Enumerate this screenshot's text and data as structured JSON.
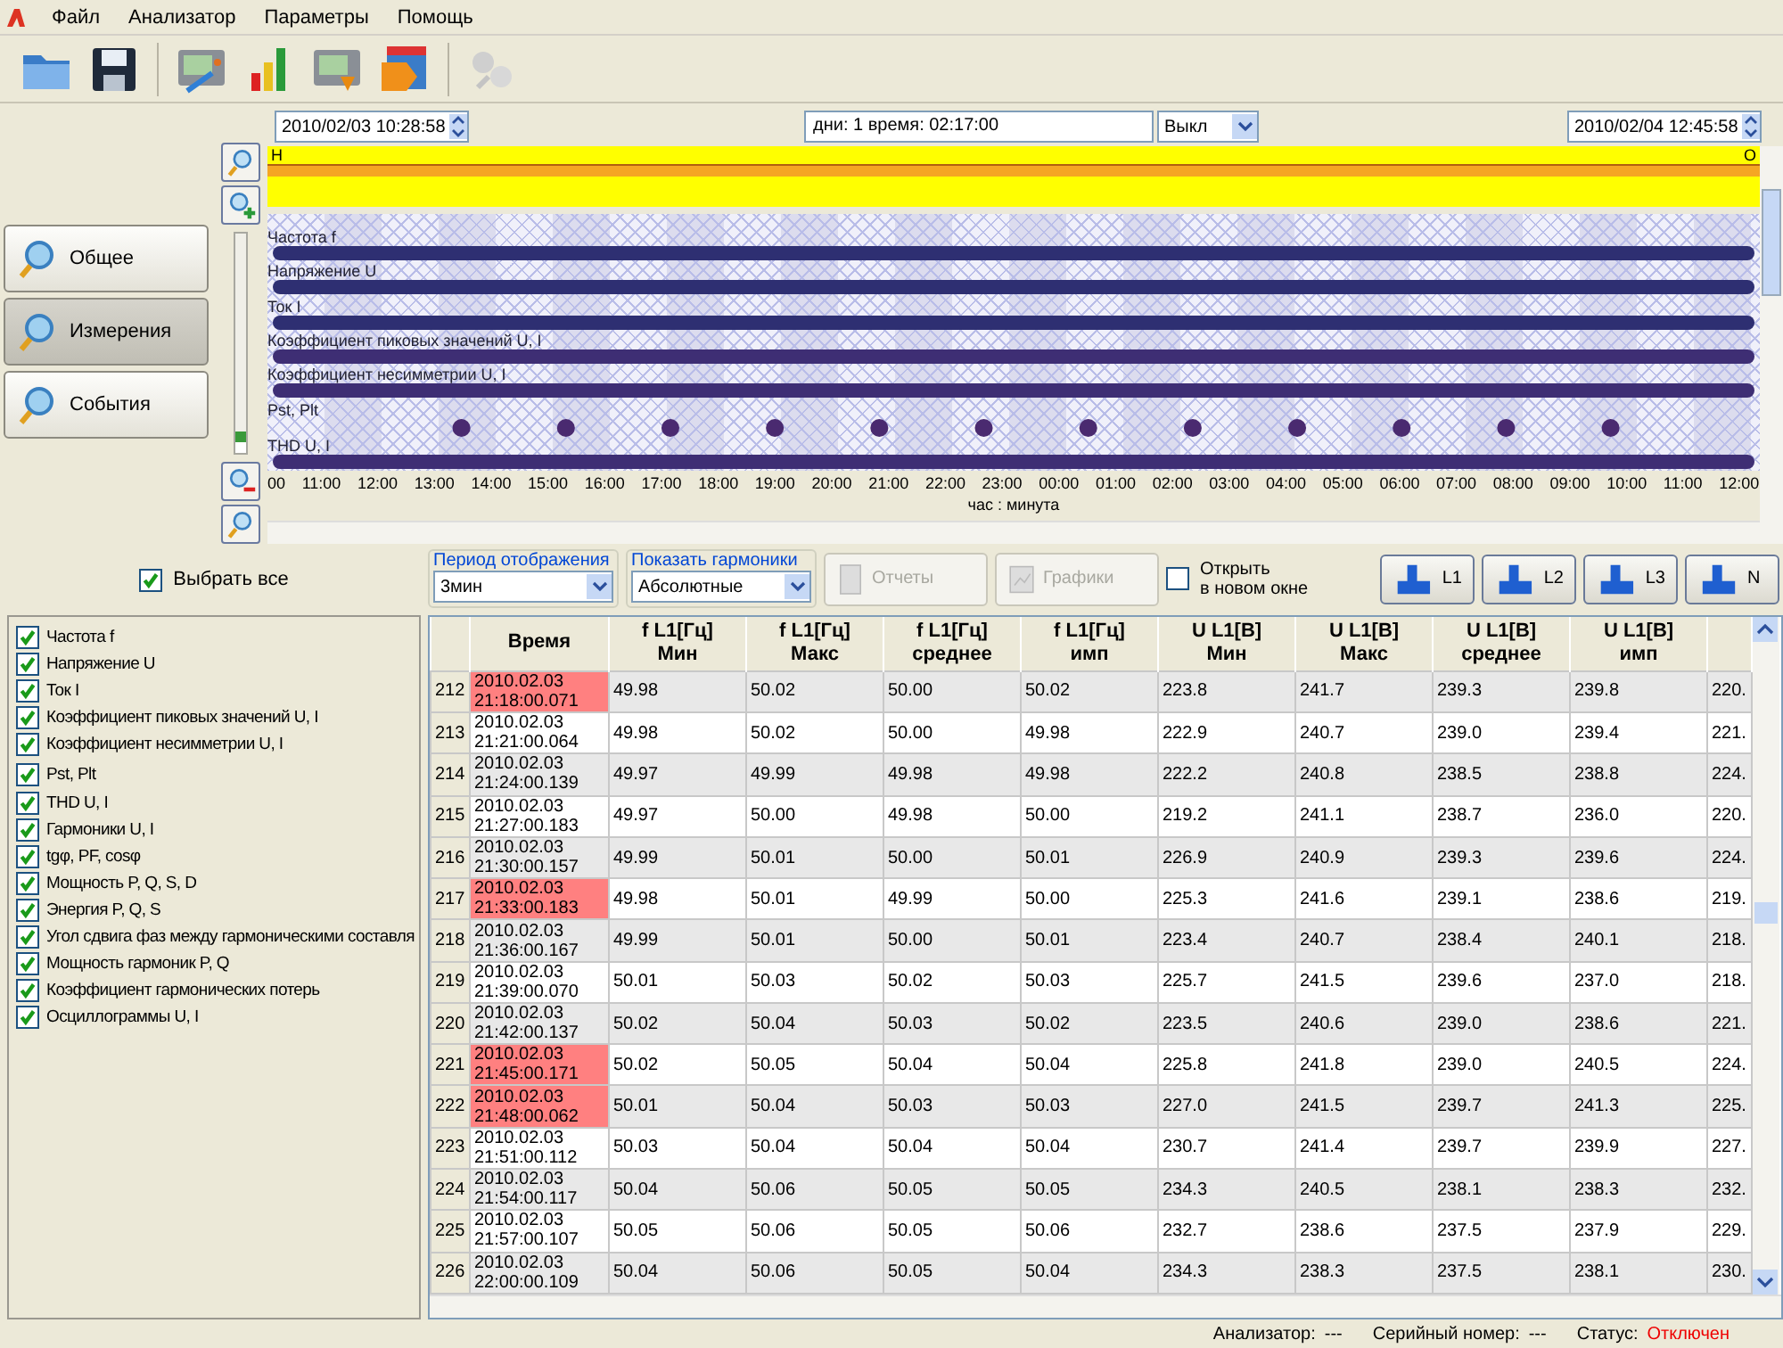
{
  "menu": [
    "Файл",
    "Анализатор",
    "Параметры",
    "Помощь"
  ],
  "timeline": {
    "start": "2010/02/03 10:28:58",
    "duration": "дни: 1 время: 02:17:00",
    "mode": "Выкл",
    "end": "2010/02/04 12:45:58",
    "start_marker": "Н",
    "end_marker": "О",
    "zoom": {
      "level": 0.95
    },
    "rows": [
      {
        "label": "Частота f",
        "kind": "bar"
      },
      {
        "label": "Напряжение U",
        "kind": "bar"
      },
      {
        "label": "Ток I",
        "kind": "bar"
      },
      {
        "label": "Коэффициент пиковых значений U, I",
        "kind": "bar"
      },
      {
        "label": "Коэффициент несимметрии U, I",
        "kind": "bar"
      },
      {
        "label": "Pst, Plt",
        "kind": "dots"
      },
      {
        "label": "THD U, I",
        "kind": "bar"
      }
    ],
    "axis_labels": [
      "00",
      "11:00",
      "12:00",
      "13:00",
      "14:00",
      "15:00",
      "16:00",
      "17:00",
      "18:00",
      "19:00",
      "20:00",
      "21:00",
      "22:00",
      "23:00",
      "00:00",
      "01:00",
      "02:00",
      "03:00",
      "04:00",
      "05:00",
      "06:00",
      "07:00",
      "08:00",
      "09:00",
      "10:00",
      "11:00",
      "12:00"
    ],
    "axis_title": "час : минута"
  },
  "nav": [
    {
      "label": "Общее",
      "selected": false
    },
    {
      "label": "Измерения",
      "selected": true
    },
    {
      "label": "События",
      "selected": false
    }
  ],
  "select_all": {
    "label": "Выбрать все",
    "checked": true
  },
  "parameters": [
    {
      "label": "Частота f",
      "checked": true
    },
    {
      "label": "Напряжение U",
      "checked": true
    },
    {
      "label": "Ток I",
      "checked": true
    },
    {
      "label": "Коэффициент пиковых значений U, I",
      "checked": true
    },
    {
      "label": "Коэффициент несимметрии U, I",
      "checked": true
    },
    {
      "label": "Pst, Plt",
      "checked": true
    },
    {
      "label": "THD U, I",
      "checked": true
    },
    {
      "label": "Гармоники U, I",
      "checked": true
    },
    {
      "label": "tgφ, PF, cosφ",
      "checked": true
    },
    {
      "label": "Мощность P, Q, S, D",
      "checked": true
    },
    {
      "label": "Энергия P, Q, S",
      "checked": true
    },
    {
      "label": "Угол сдвига фаз между гармоническими составля",
      "checked": true
    },
    {
      "label": "Мощность гармоник P, Q",
      "checked": true
    },
    {
      "label": "Коэффициент гармонических потерь",
      "checked": true
    },
    {
      "label": "Осциллограммы U, I",
      "checked": true
    }
  ],
  "controls": {
    "period_label": "Период отображения",
    "period": "3мин",
    "harmonics_label": "Показать гармоники",
    "harmonics": "Абсолютные",
    "reports": {
      "label": "Отчеты",
      "disabled": true
    },
    "graphs": {
      "label": "Графики",
      "disabled": true
    },
    "new_window": {
      "label": "Открыть\nв новом окне",
      "checked": false
    }
  },
  "phases": [
    "L1",
    "L2",
    "L3",
    "N"
  ],
  "table": {
    "columns": [
      {
        "name": "Время"
      },
      {
        "name": "f L1[Гц]",
        "stat": "Мин"
      },
      {
        "name": "f L1[Гц]",
        "stat": "Макс"
      },
      {
        "name": "f L1[Гц]",
        "stat": "среднее"
      },
      {
        "name": "f L1[Гц]",
        "stat": "имп"
      },
      {
        "name": "U L1[В]",
        "stat": "Мин"
      },
      {
        "name": "U L1[В]",
        "stat": "Макс"
      },
      {
        "name": "U L1[В]",
        "stat": "среднее"
      },
      {
        "name": "U L1[В]",
        "stat": "имп"
      }
    ],
    "rows": [
      {
        "n": "212",
        "time": "2010.02.03\n21:18:00.071",
        "flagged": true,
        "values": [
          "49.98",
          "50.02",
          "50.00",
          "50.02",
          "223.8",
          "241.7",
          "239.3",
          "239.8",
          "220."
        ]
      },
      {
        "n": "213",
        "time": "2010.02.03\n21:21:00.064",
        "flagged": false,
        "values": [
          "49.98",
          "50.02",
          "50.00",
          "49.98",
          "222.9",
          "240.7",
          "239.0",
          "239.4",
          "221."
        ]
      },
      {
        "n": "214",
        "time": "2010.02.03\n21:24:00.139",
        "flagged": false,
        "values": [
          "49.97",
          "49.99",
          "49.98",
          "49.98",
          "222.2",
          "240.8",
          "238.5",
          "238.8",
          "224."
        ]
      },
      {
        "n": "215",
        "time": "2010.02.03\n21:27:00.183",
        "flagged": false,
        "values": [
          "49.97",
          "50.00",
          "49.98",
          "50.00",
          "219.2",
          "241.1",
          "238.7",
          "236.0",
          "220."
        ]
      },
      {
        "n": "216",
        "time": "2010.02.03\n21:30:00.157",
        "flagged": false,
        "values": [
          "49.99",
          "50.01",
          "50.00",
          "50.01",
          "226.9",
          "240.9",
          "239.3",
          "239.6",
          "224."
        ]
      },
      {
        "n": "217",
        "time": "2010.02.03\n21:33:00.183",
        "flagged": true,
        "values": [
          "49.98",
          "50.01",
          "49.99",
          "50.00",
          "225.3",
          "241.6",
          "239.1",
          "238.6",
          "219."
        ]
      },
      {
        "n": "218",
        "time": "2010.02.03\n21:36:00.167",
        "flagged": false,
        "values": [
          "49.99",
          "50.01",
          "50.00",
          "50.01",
          "223.4",
          "240.7",
          "238.4",
          "240.1",
          "218."
        ]
      },
      {
        "n": "219",
        "time": "2010.02.03\n21:39:00.070",
        "flagged": false,
        "values": [
          "50.01",
          "50.03",
          "50.02",
          "50.03",
          "225.7",
          "241.5",
          "239.6",
          "237.0",
          "218."
        ]
      },
      {
        "n": "220",
        "time": "2010.02.03\n21:42:00.137",
        "flagged": false,
        "values": [
          "50.02",
          "50.04",
          "50.03",
          "50.02",
          "223.5",
          "240.6",
          "239.0",
          "238.6",
          "221."
        ]
      },
      {
        "n": "221",
        "time": "2010.02.03\n21:45:00.171",
        "flagged": true,
        "values": [
          "50.02",
          "50.05",
          "50.04",
          "50.04",
          "225.8",
          "241.8",
          "239.0",
          "240.5",
          "224."
        ]
      },
      {
        "n": "222",
        "time": "2010.02.03\n21:48:00.062",
        "flagged": true,
        "values": [
          "50.01",
          "50.04",
          "50.03",
          "50.03",
          "227.0",
          "241.5",
          "239.7",
          "241.3",
          "225."
        ]
      },
      {
        "n": "223",
        "time": "2010.02.03\n21:51:00.112",
        "flagged": false,
        "values": [
          "50.03",
          "50.04",
          "50.04",
          "50.04",
          "230.7",
          "241.4",
          "239.7",
          "239.9",
          "227."
        ]
      },
      {
        "n": "224",
        "time": "2010.02.03\n21:54:00.117",
        "flagged": false,
        "values": [
          "50.04",
          "50.06",
          "50.05",
          "50.05",
          "234.3",
          "240.5",
          "238.1",
          "238.3",
          "232."
        ]
      },
      {
        "n": "225",
        "time": "2010.02.03\n21:57:00.107",
        "flagged": false,
        "values": [
          "50.05",
          "50.06",
          "50.05",
          "50.06",
          "232.7",
          "238.6",
          "237.5",
          "237.9",
          "229."
        ]
      },
      {
        "n": "226",
        "time": "2010.02.03\n22:00:00.109",
        "flagged": false,
        "values": [
          "50.04",
          "50.06",
          "50.05",
          "50.04",
          "234.3",
          "238.3",
          "237.5",
          "238.1",
          "230."
        ]
      }
    ]
  },
  "status": [
    {
      "label": "Анализатор:",
      "value": "---",
      "kind": "plain"
    },
    {
      "label": "Серийный номер:",
      "value": "---",
      "kind": "plain"
    },
    {
      "label": "Статус:",
      "value": "Отключен",
      "kind": "alert"
    }
  ]
}
